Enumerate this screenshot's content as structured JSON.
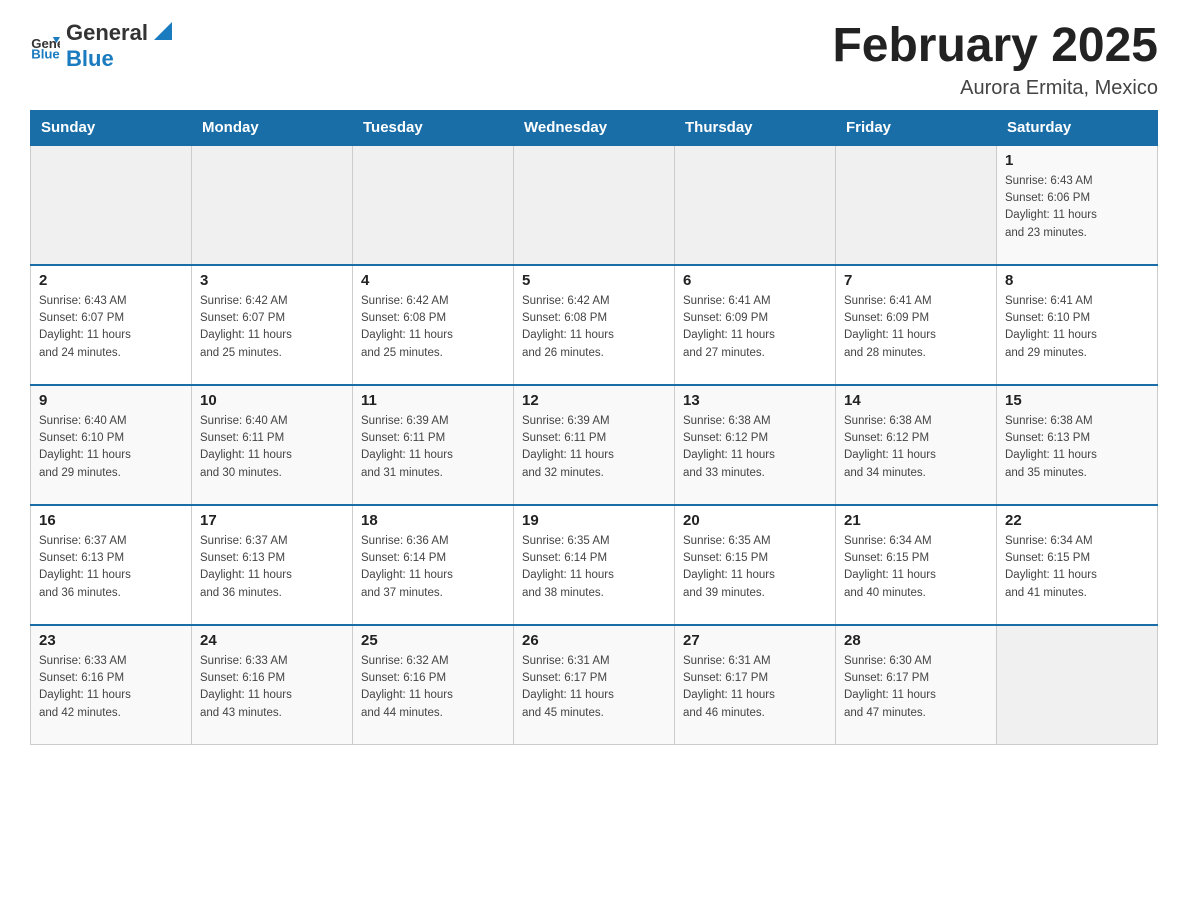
{
  "header": {
    "logo_general": "General",
    "logo_blue": "Blue",
    "month_title": "February 2025",
    "location": "Aurora Ermita, Mexico"
  },
  "days_of_week": [
    "Sunday",
    "Monday",
    "Tuesday",
    "Wednesday",
    "Thursday",
    "Friday",
    "Saturday"
  ],
  "weeks": [
    [
      {
        "day": "",
        "info": ""
      },
      {
        "day": "",
        "info": ""
      },
      {
        "day": "",
        "info": ""
      },
      {
        "day": "",
        "info": ""
      },
      {
        "day": "",
        "info": ""
      },
      {
        "day": "",
        "info": ""
      },
      {
        "day": "1",
        "info": "Sunrise: 6:43 AM\nSunset: 6:06 PM\nDaylight: 11 hours\nand 23 minutes."
      }
    ],
    [
      {
        "day": "2",
        "info": "Sunrise: 6:43 AM\nSunset: 6:07 PM\nDaylight: 11 hours\nand 24 minutes."
      },
      {
        "day": "3",
        "info": "Sunrise: 6:42 AM\nSunset: 6:07 PM\nDaylight: 11 hours\nand 25 minutes."
      },
      {
        "day": "4",
        "info": "Sunrise: 6:42 AM\nSunset: 6:08 PM\nDaylight: 11 hours\nand 25 minutes."
      },
      {
        "day": "5",
        "info": "Sunrise: 6:42 AM\nSunset: 6:08 PM\nDaylight: 11 hours\nand 26 minutes."
      },
      {
        "day": "6",
        "info": "Sunrise: 6:41 AM\nSunset: 6:09 PM\nDaylight: 11 hours\nand 27 minutes."
      },
      {
        "day": "7",
        "info": "Sunrise: 6:41 AM\nSunset: 6:09 PM\nDaylight: 11 hours\nand 28 minutes."
      },
      {
        "day": "8",
        "info": "Sunrise: 6:41 AM\nSunset: 6:10 PM\nDaylight: 11 hours\nand 29 minutes."
      }
    ],
    [
      {
        "day": "9",
        "info": "Sunrise: 6:40 AM\nSunset: 6:10 PM\nDaylight: 11 hours\nand 29 minutes."
      },
      {
        "day": "10",
        "info": "Sunrise: 6:40 AM\nSunset: 6:11 PM\nDaylight: 11 hours\nand 30 minutes."
      },
      {
        "day": "11",
        "info": "Sunrise: 6:39 AM\nSunset: 6:11 PM\nDaylight: 11 hours\nand 31 minutes."
      },
      {
        "day": "12",
        "info": "Sunrise: 6:39 AM\nSunset: 6:11 PM\nDaylight: 11 hours\nand 32 minutes."
      },
      {
        "day": "13",
        "info": "Sunrise: 6:38 AM\nSunset: 6:12 PM\nDaylight: 11 hours\nand 33 minutes."
      },
      {
        "day": "14",
        "info": "Sunrise: 6:38 AM\nSunset: 6:12 PM\nDaylight: 11 hours\nand 34 minutes."
      },
      {
        "day": "15",
        "info": "Sunrise: 6:38 AM\nSunset: 6:13 PM\nDaylight: 11 hours\nand 35 minutes."
      }
    ],
    [
      {
        "day": "16",
        "info": "Sunrise: 6:37 AM\nSunset: 6:13 PM\nDaylight: 11 hours\nand 36 minutes."
      },
      {
        "day": "17",
        "info": "Sunrise: 6:37 AM\nSunset: 6:13 PM\nDaylight: 11 hours\nand 36 minutes."
      },
      {
        "day": "18",
        "info": "Sunrise: 6:36 AM\nSunset: 6:14 PM\nDaylight: 11 hours\nand 37 minutes."
      },
      {
        "day": "19",
        "info": "Sunrise: 6:35 AM\nSunset: 6:14 PM\nDaylight: 11 hours\nand 38 minutes."
      },
      {
        "day": "20",
        "info": "Sunrise: 6:35 AM\nSunset: 6:15 PM\nDaylight: 11 hours\nand 39 minutes."
      },
      {
        "day": "21",
        "info": "Sunrise: 6:34 AM\nSunset: 6:15 PM\nDaylight: 11 hours\nand 40 minutes."
      },
      {
        "day": "22",
        "info": "Sunrise: 6:34 AM\nSunset: 6:15 PM\nDaylight: 11 hours\nand 41 minutes."
      }
    ],
    [
      {
        "day": "23",
        "info": "Sunrise: 6:33 AM\nSunset: 6:16 PM\nDaylight: 11 hours\nand 42 minutes."
      },
      {
        "day": "24",
        "info": "Sunrise: 6:33 AM\nSunset: 6:16 PM\nDaylight: 11 hours\nand 43 minutes."
      },
      {
        "day": "25",
        "info": "Sunrise: 6:32 AM\nSunset: 6:16 PM\nDaylight: 11 hours\nand 44 minutes."
      },
      {
        "day": "26",
        "info": "Sunrise: 6:31 AM\nSunset: 6:17 PM\nDaylight: 11 hours\nand 45 minutes."
      },
      {
        "day": "27",
        "info": "Sunrise: 6:31 AM\nSunset: 6:17 PM\nDaylight: 11 hours\nand 46 minutes."
      },
      {
        "day": "28",
        "info": "Sunrise: 6:30 AM\nSunset: 6:17 PM\nDaylight: 11 hours\nand 47 minutes."
      },
      {
        "day": "",
        "info": ""
      }
    ]
  ]
}
